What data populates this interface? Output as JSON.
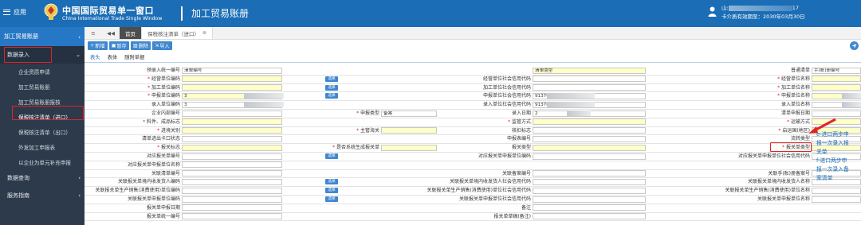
{
  "header": {
    "menu_label": "应用",
    "brand_cn": "中国国际贸易单一窗口",
    "brand_en": "China International Trade Single Window",
    "app_title": "加工贸易账册",
    "user_line1_prefix": "山:",
    "user_line1_suffix": "17",
    "user_line2": "卡介质有效期至：2030年03月30日"
  },
  "sidebar": {
    "top": "加工贸易账册",
    "data_entry": "数据录入",
    "items": [
      "企业资质申请",
      "加工贸易账册",
      "加工贸易账册报核",
      "保税核注清单（进口）",
      "保税核注清单（出口）",
      "外发加工申报表",
      "以企业为单元补充申报"
    ],
    "query": "数据查询",
    "guide": "服务指南"
  },
  "tabbar": {
    "menu": "≡",
    "back": "◀◀",
    "home": "首页",
    "current": "保税核注清单（进口）"
  },
  "toolbar": {
    "new": "新增",
    "save": "暂存",
    "delete": "删除",
    "import": "导入"
  },
  "subtabs": [
    "表头",
    "表体",
    "随附单据"
  ],
  "form": {
    "rows": [
      [
        "预录入统一编号",
        "清单编号",
        "",
        "清单类型",
        "普通清单",
        "手(账)册编号"
      ],
      [
        "经营单位编码",
        "",
        "经营单位社会信用代码",
        "",
        "经营单位名称",
        ""
      ],
      [
        "加工单位编码",
        "",
        "加工单位社会信用代码",
        "",
        "加工单位名称",
        ""
      ],
      [
        "申报单位编码",
        "3",
        "申报单位社会信用代码",
        "91370",
        "申报单位名称",
        ""
      ],
      [
        "录入单位编码",
        "3",
        "录入单位社会信用代码",
        "91370",
        "录入单位名称",
        ""
      ],
      [
        "企业内部编号",
        "",
        "申报类型",
        "备案",
        "录入日期",
        "2",
        "清单申报日期",
        ""
      ],
      [
        "料件、成品标志",
        "",
        "监管方式",
        "",
        "运输方式",
        ""
      ],
      [
        "进境关别",
        "",
        "主管海关",
        "",
        "核扣标志",
        "",
        "启运国(地区)",
        ""
      ],
      [
        "清单进出卡口状态",
        "",
        "申报表编号",
        "",
        "流转类型",
        ""
      ],
      [
        "报关标志",
        "",
        "是否系统生成报关单",
        "",
        "报关类型",
        "",
        "报关单类型",
        ""
      ],
      [
        "对应报关单编号",
        "",
        "对应报关单申报单位编码",
        "",
        "对应报关单申报单位社会信用代码",
        ""
      ],
      [
        "对应报关单申报单位名称",
        ""
      ],
      [
        "关联清单编号",
        "",
        "关联备案编号",
        "",
        "关联手(账)册备案号",
        ""
      ],
      [
        "关联报关单境内收发货人编码",
        "",
        "关联报关单境内收发货人社会信用代码",
        "",
        "关联报关单境内收发货人名称",
        ""
      ],
      [
        "关联报关单生产销售(消费使用)单位编码",
        "",
        "关联报关单生产销售(消费使用)单位社会信用代码",
        "",
        "关联报关单生产销售(消费使用)单位名称",
        ""
      ],
      [
        "关联报关单申报单位编码",
        "",
        "关联报关单申报单位社会信用代码",
        "",
        "关联报关单申报单位名称",
        ""
      ],
      [
        "报关单申报日期",
        "",
        "备注",
        ""
      ],
      [
        "报关单统一编号",
        "",
        "报关单草稿(备注)",
        ""
      ]
    ],
    "select_label": "选择"
  },
  "right_panel": [
    "e-进口两步申",
    "报一次录入报",
    "关单",
    "f-进口两步申",
    "报一次录入备",
    "案清单"
  ],
  "colors": {
    "header_blue": "#1b6db5",
    "sidebar_dark": "#2d3a4b",
    "highlight_red": "#e02424",
    "required_yellow": "#ffffc8"
  }
}
